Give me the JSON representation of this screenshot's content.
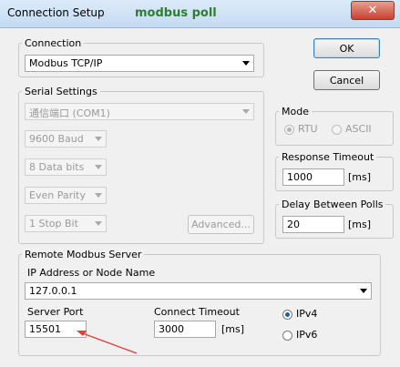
{
  "window": {
    "title": "Connection Setup",
    "watermark": "modbus poll",
    "close_glyph": "✕"
  },
  "buttons": {
    "ok": "OK",
    "cancel": "Cancel",
    "advanced": "Advanced..."
  },
  "connection": {
    "label": "Connection",
    "value": "Modbus TCP/IP"
  },
  "serial": {
    "label": "Serial Settings",
    "port": "通信端口 (COM1)",
    "baud": "9600 Baud",
    "data_bits": "8 Data bits",
    "parity": "Even Parity",
    "stop_bits": "1 Stop Bit"
  },
  "mode": {
    "label": "Mode",
    "rtu": "RTU",
    "ascii": "ASCII",
    "selected": "RTU"
  },
  "response_timeout": {
    "label": "Response Timeout",
    "value": "1000",
    "unit": "[ms]"
  },
  "delay_polls": {
    "label": "Delay Between Polls",
    "value": "20",
    "unit": "[ms]"
  },
  "remote": {
    "label": "Remote Modbus Server",
    "ip_label": "IP Address or Node Name",
    "ip_value": "127.0.0.1",
    "port_label": "Server Port",
    "port_value": "15501",
    "timeout_label": "Connect Timeout",
    "timeout_value": "3000",
    "timeout_unit": "[ms]",
    "ipv4": "IPv4",
    "ipv6": "IPv6",
    "selected_ip": "IPv4"
  },
  "colors": {
    "annotation_arrow": "#e53935",
    "watermark": "#2f7d32"
  }
}
